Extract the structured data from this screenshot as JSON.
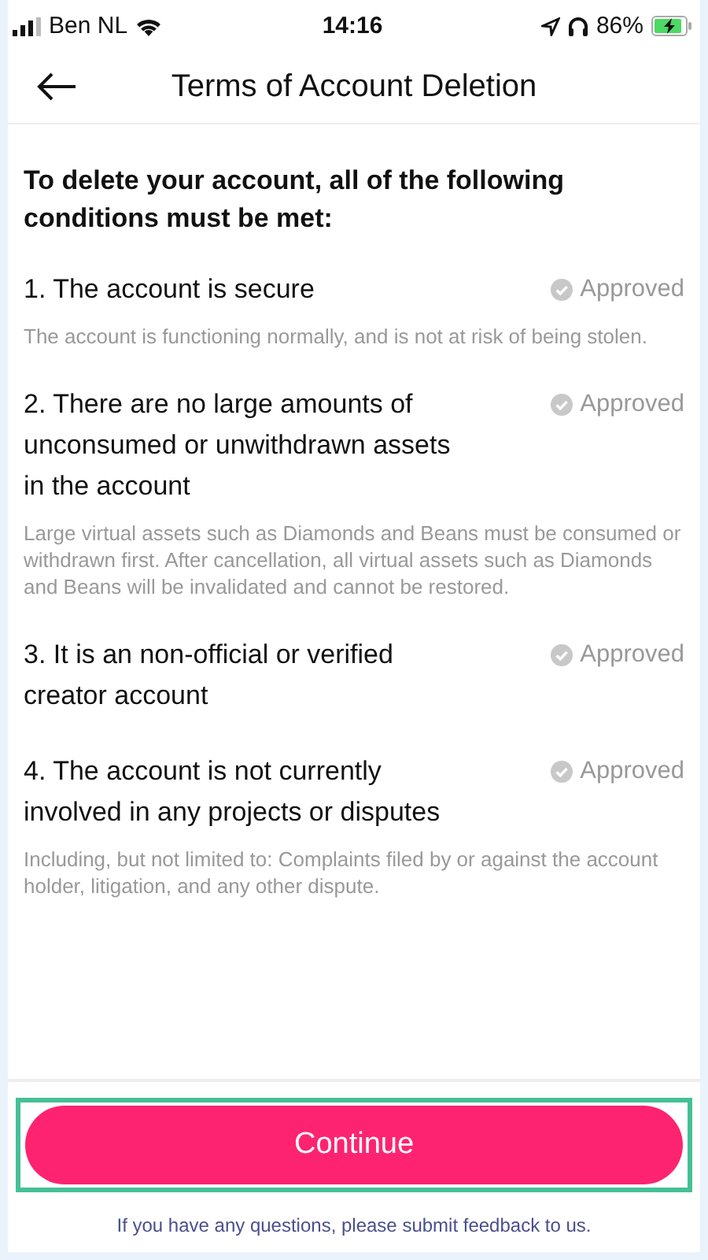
{
  "status_bar": {
    "carrier": "Ben NL",
    "time": "14:16",
    "battery": "86%"
  },
  "header": {
    "title": "Terms of Account Deletion"
  },
  "intro": "To delete your account, all of the following conditions must be met:",
  "conditions": [
    {
      "title": "1. The account is secure",
      "status": "Approved",
      "approved": true,
      "description": "The account is functioning normally, and is not at risk of being stolen."
    },
    {
      "title": "2. There are no large amounts of unconsumed or unwithdrawn assets in the account",
      "status": "Approved",
      "approved": true,
      "description": "Large virtual assets such as Diamonds and Beans must be consumed or withdrawn first. After cancellation, all virtual assets such as Diamonds and Beans will be invalidated and cannot be restored."
    },
    {
      "title": "3. It is an non-official or verified creator account",
      "status": "Approved",
      "approved": true
    },
    {
      "title": "4. The account is not currently involved in any projects or disputes",
      "status": "Approved",
      "approved": true,
      "description": "Including, but not limited to: Complaints filed by or against the account holder, litigation, and any other dispute."
    }
  ],
  "continue_button": {
    "label": "Continue",
    "highlighted": true
  },
  "feedback_link": "If you have any questions, please submit feedback to us."
}
